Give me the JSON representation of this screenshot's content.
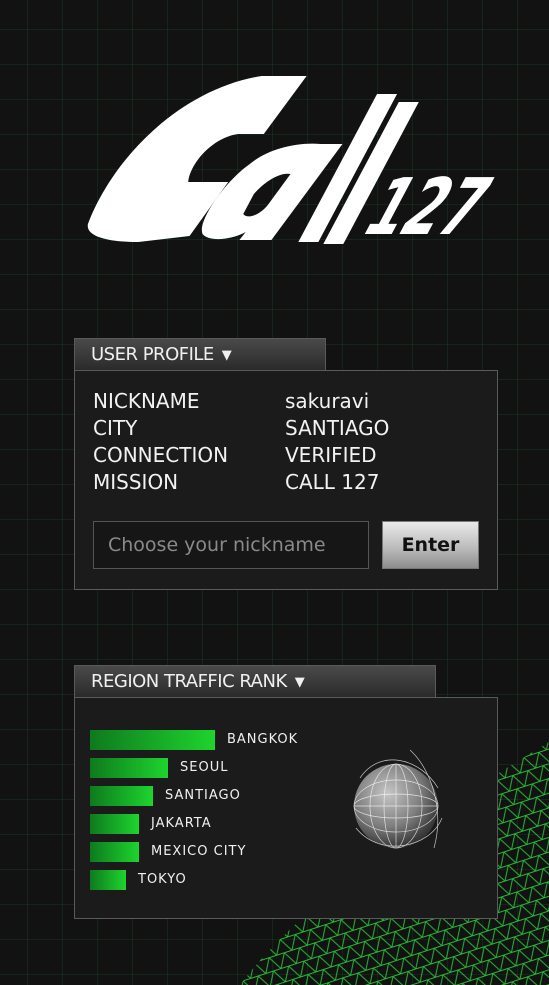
{
  "logo": {
    "text": "Call 127"
  },
  "user_profile": {
    "tab_label": "USER PROFILE",
    "caret": "▼",
    "rows": [
      {
        "key": "NICKNAME",
        "value": "sakuravi"
      },
      {
        "key": "CITY",
        "value": "SANTIAGO"
      },
      {
        "key": "CONNECTION",
        "value": "VERIFIED"
      },
      {
        "key": "MISSION",
        "value": "CALL 127"
      }
    ],
    "nickname_input": {
      "placeholder": "Choose your nickname",
      "value": ""
    },
    "enter_label": "Enter"
  },
  "traffic_rank": {
    "tab_label": "REGION TRAFFIC RANK",
    "caret": "▼",
    "regions": [
      {
        "name": "BANGKOK",
        "value": 100
      },
      {
        "name": "SEOUL",
        "value": 62
      },
      {
        "name": "SANTIAGO",
        "value": 50
      },
      {
        "name": "JAKARTA",
        "value": 39
      },
      {
        "name": "MEXICO CITY",
        "value": 39
      },
      {
        "name": "TOKYO",
        "value": 29
      }
    ],
    "bar_color_start": "#0e7a1e",
    "bar_color_end": "#1ed42e"
  },
  "theme": {
    "accent": "#1ed42e",
    "background": "#121212"
  }
}
